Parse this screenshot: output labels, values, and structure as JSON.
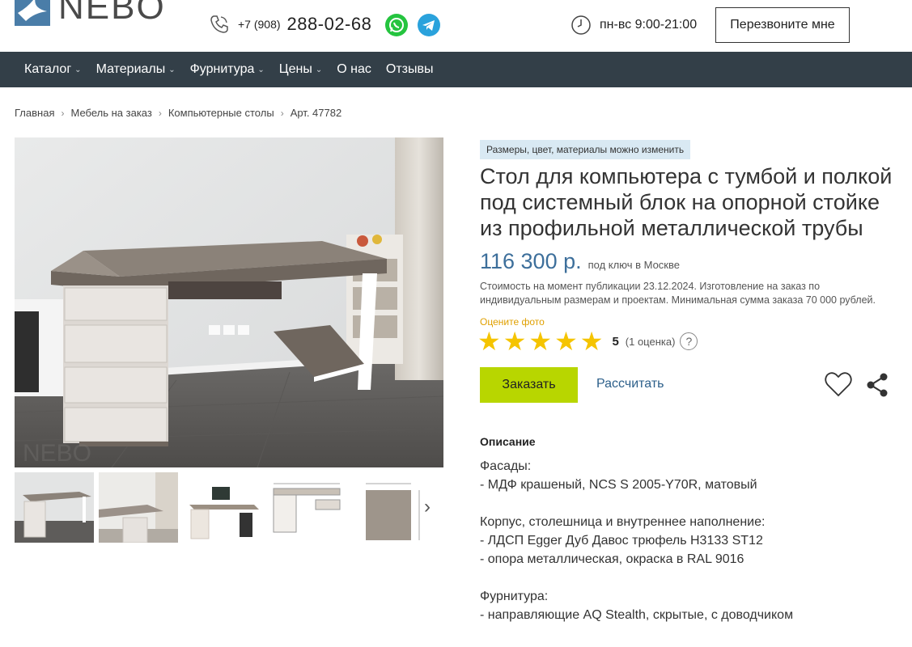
{
  "header": {
    "logo_text": "NEBO",
    "phone_code": "+7 (908)",
    "phone_number": "288-02-68",
    "hours": "пн-вс 9:00-21:00",
    "callback_label": "Перезвоните мне"
  },
  "nav": {
    "items": [
      {
        "label": "Каталог",
        "dropdown": true
      },
      {
        "label": "Материалы",
        "dropdown": true
      },
      {
        "label": "Фурнитура",
        "dropdown": true
      },
      {
        "label": "Цены",
        "dropdown": true
      },
      {
        "label": "О нас",
        "dropdown": false
      },
      {
        "label": "Отзывы",
        "dropdown": false
      }
    ]
  },
  "breadcrumb": [
    "Главная",
    "Мебель на заказ",
    "Компьютерные столы",
    "Арт. 47782"
  ],
  "product": {
    "tag": "Размеры, цвет, материалы можно изменить",
    "title": "Стол для компьютера с тумбой и полкой под системный блок на опорной стойке из профильной металлической трубы",
    "price": "116 300 р.",
    "price_note": "под ключ в Москве",
    "note": "Стоимость на момент публикации 23.12.2024. Изготовление на заказ по индивидуальным размерам и проектам. Минимальная сумма заказа 70 000 рублей.",
    "rate_label": "Оцените фото",
    "stars": 5,
    "rating_value": "5",
    "rating_count": "(1 оценка)",
    "help_glyph": "?",
    "order_label": "Заказать",
    "calc_label": "Рассчитать"
  },
  "description": {
    "title": "Описание",
    "lines": [
      "Фасады:",
      "- МДФ крашеный, NCS S 2005-Y70R, матовый",
      "",
      "Корпус, столешница и внутреннее наполнение:",
      "- ЛДСП Egger Дуб Давос трюфель H3133 ST12",
      "- опора металлическая, окраска в RAL 9016",
      "",
      "Фурнитура:",
      "- направляющие AQ Stealth, скрытые, с доводчиком"
    ]
  },
  "colors": {
    "nav_bg": "#333f48",
    "accent_blue": "#3d6f9b",
    "order_green": "#b8d600",
    "star": "#f5c400",
    "tag_bg": "#d9e9f3"
  },
  "icons": [
    "phone-icon",
    "whatsapp-icon",
    "telegram-icon",
    "clock-icon",
    "chevron-down-icon",
    "chevron-right-icon",
    "star-icon",
    "help-icon",
    "heart-icon",
    "share-icon"
  ]
}
